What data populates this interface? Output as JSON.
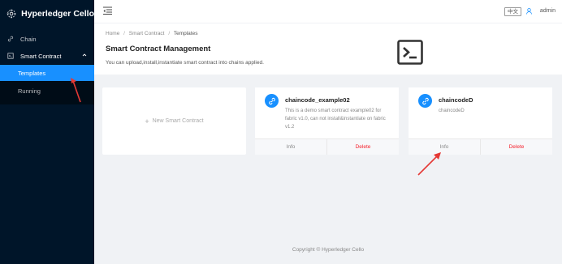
{
  "brand": {
    "name": "Hyperledger Cello"
  },
  "sidebar": {
    "chain_label": "Chain",
    "smart_contract_label": "Smart Contract",
    "templates_label": "Templates",
    "running_label": "Running"
  },
  "header": {
    "lang": "中文",
    "user": "admin"
  },
  "breadcrumb": {
    "home": "Home",
    "smart_contract": "Smart Contract",
    "current": "Templates"
  },
  "page": {
    "title": "Smart Contract Management",
    "description": "You can upload,install,instantiate smart contract into chains applied."
  },
  "new_card": {
    "label": "New Smart Contract"
  },
  "cards": [
    {
      "title": "chaincode_example02",
      "description": "This is a demo smart contract example02 for fabric v1.0, can not install&instantiate on fabric v1.2",
      "info": "Info",
      "delete": "Delete"
    },
    {
      "title": "chaincodeD",
      "description": "chaincodeD",
      "info": "Info",
      "delete": "Delete"
    }
  ],
  "footer": {
    "copyright": "Copyright © Hyperledger Cello"
  },
  "colors": {
    "sidebar": "#001529",
    "accent": "#1890ff",
    "danger": "#f5222d",
    "annotation": "#e53935"
  },
  "icons": [
    "cello-logo-icon",
    "link-icon",
    "contract-icon",
    "chevron-up-icon",
    "menu-fold-icon",
    "user-icon",
    "terminal-icon"
  ]
}
